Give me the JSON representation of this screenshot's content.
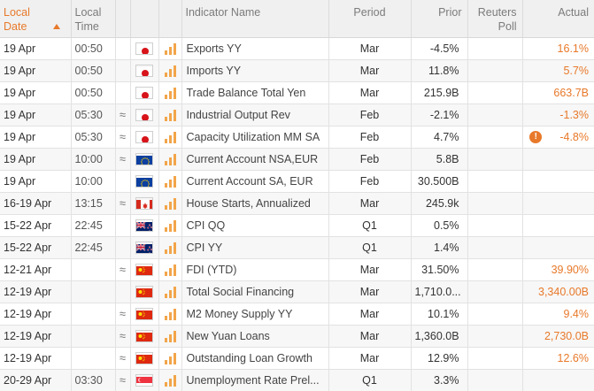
{
  "header": {
    "local_date": "Local Date",
    "local_time": "Local Time",
    "indicator_name": "Indicator Name",
    "period": "Period",
    "prior": "Prior",
    "reuters_poll": "Reuters Poll",
    "actual": "Actual"
  },
  "colors": {
    "accent": "#e8792a",
    "header_bg": "#f0f0f0",
    "bar_icon": "#f2a54a"
  },
  "rows": [
    {
      "date": "19 Apr",
      "time": "00:50",
      "approx": "",
      "country": "JP",
      "name": "Exports YY",
      "period": "Mar",
      "prior": "-4.5%",
      "poll": "",
      "warning": false,
      "actual": "16.1%"
    },
    {
      "date": "19 Apr",
      "time": "00:50",
      "approx": "",
      "country": "JP",
      "name": "Imports YY",
      "period": "Mar",
      "prior": "11.8%",
      "poll": "",
      "warning": false,
      "actual": "5.7%"
    },
    {
      "date": "19 Apr",
      "time": "00:50",
      "approx": "",
      "country": "JP",
      "name": "Trade Balance Total Yen",
      "period": "Mar",
      "prior": "215.9B",
      "poll": "",
      "warning": false,
      "actual": "663.7B"
    },
    {
      "date": "19 Apr",
      "time": "05:30",
      "approx": "≈",
      "country": "JP",
      "name": "Industrial Output Rev",
      "period": "Feb",
      "prior": "-2.1%",
      "poll": "",
      "warning": false,
      "actual": "-1.3%"
    },
    {
      "date": "19 Apr",
      "time": "05:30",
      "approx": "≈",
      "country": "JP",
      "name": "Capacity Utilization MM SA",
      "period": "Feb",
      "prior": "4.7%",
      "poll": "",
      "warning": true,
      "actual": "-4.8%"
    },
    {
      "date": "19 Apr",
      "time": "10:00",
      "approx": "≈",
      "country": "EU",
      "name": "Current Account NSA,EUR",
      "period": "Feb",
      "prior": "5.8B",
      "poll": "",
      "warning": false,
      "actual": ""
    },
    {
      "date": "19 Apr",
      "time": "10:00",
      "approx": "",
      "country": "EU",
      "name": "Current Account SA, EUR",
      "period": "Feb",
      "prior": "30.500B",
      "poll": "",
      "warning": false,
      "actual": ""
    },
    {
      "date": "16-19 Apr",
      "time": "13:15",
      "approx": "≈",
      "country": "CA",
      "name": "House Starts, Annualized",
      "period": "Mar",
      "prior": "245.9k",
      "poll": "",
      "warning": false,
      "actual": ""
    },
    {
      "date": "15-22 Apr",
      "time": "22:45",
      "approx": "",
      "country": "NZ",
      "name": "CPI QQ",
      "period": "Q1",
      "prior": "0.5%",
      "poll": "",
      "warning": false,
      "actual": ""
    },
    {
      "date": "15-22 Apr",
      "time": "22:45",
      "approx": "",
      "country": "NZ",
      "name": "CPI YY",
      "period": "Q1",
      "prior": "1.4%",
      "poll": "",
      "warning": false,
      "actual": ""
    },
    {
      "date": "12-21 Apr",
      "time": "",
      "approx": "≈",
      "country": "CN",
      "name": "FDI (YTD)",
      "period": "Mar",
      "prior": "31.50%",
      "poll": "",
      "warning": false,
      "actual": "39.90%"
    },
    {
      "date": "12-19 Apr",
      "time": "",
      "approx": "",
      "country": "CN",
      "name": "Total Social Financing",
      "period": "Mar",
      "prior": "1,710.0...",
      "poll": "",
      "warning": false,
      "actual": "3,340.00B"
    },
    {
      "date": "12-19 Apr",
      "time": "",
      "approx": "≈",
      "country": "CN",
      "name": "M2 Money Supply YY",
      "period": "Mar",
      "prior": "10.1%",
      "poll": "",
      "warning": false,
      "actual": "9.4%"
    },
    {
      "date": "12-19 Apr",
      "time": "",
      "approx": "≈",
      "country": "CN",
      "name": "New Yuan Loans",
      "period": "Mar",
      "prior": "1,360.0B",
      "poll": "",
      "warning": false,
      "actual": "2,730.0B"
    },
    {
      "date": "12-19 Apr",
      "time": "",
      "approx": "≈",
      "country": "CN",
      "name": "Outstanding Loan Growth",
      "period": "Mar",
      "prior": "12.9%",
      "poll": "",
      "warning": false,
      "actual": "12.6%"
    },
    {
      "date": "20-29 Apr",
      "time": "03:30",
      "approx": "≈",
      "country": "SG",
      "name": "Unemployment Rate Prel...",
      "period": "Q1",
      "prior": "3.3%",
      "poll": "",
      "warning": false,
      "actual": ""
    }
  ]
}
